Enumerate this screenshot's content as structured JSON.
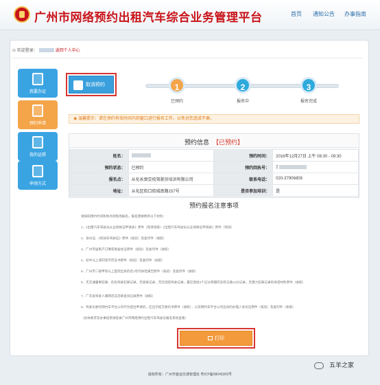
{
  "header": {
    "title": "广州市网络预约出租汽车综合业务管理平台",
    "nav": [
      "首页",
      "通知公告",
      "办事指南"
    ]
  },
  "breadcrumb": {
    "welcome": "欢迎登录：",
    "home": "返回个人中心"
  },
  "sidebar": {
    "items": [
      {
        "label": "我要办证",
        "active": false,
        "icon": "id-card-icon"
      },
      {
        "label": "预约申请",
        "active": true,
        "icon": "form-icon"
      },
      {
        "label": "我的证照",
        "active": false,
        "icon": "license-icon"
      },
      {
        "label": "申领方式",
        "active": false,
        "icon": "apply-icon"
      }
    ]
  },
  "cancel_button": {
    "label": "取消预约"
  },
  "progress": {
    "steps": [
      {
        "number": "1",
        "label": "已预约",
        "color": "#f4a54a"
      },
      {
        "number": "2",
        "label": "报名中",
        "color": "#2eaadc"
      },
      {
        "number": "3",
        "label": "报名完成",
        "color": "#2eaadc"
      }
    ]
  },
  "notice": {
    "text": "温馨提示：请在预约有效时间内到窗口进行报名工作，以免对您造成不便。"
  },
  "info": {
    "title": "预约信息",
    "status": "【已预约】",
    "rows": [
      [
        "姓名：",
        "",
        "预约时间：",
        "2016年12月27日 上午 08:30 - 09:30"
      ],
      [
        "预约状态：",
        "已预约",
        "预约回执号：",
        "2"
      ],
      [
        "报名点：",
        "从化长颈交校驾驶员培训有限公司",
        "联系电话：",
        "020-37906808"
      ],
      [
        "地址：",
        "从化区街口街城南路157号",
        "是否参加培训：",
        "是"
      ]
    ]
  },
  "registration": {
    "title": "预约报名注意事项",
    "lines": [
      "请按照预约时间和地点到现场报名，报名需要携带以下材料：",
      "1、《出租汽车驾驶员从业资格证申请表》原件（现场领取）《出租汽车驾驶员从业资格证申请表》原件（现场）",
      "2、身份证、《机动车驾驶证》原件（核验）及复印件（收取）",
      "3、广州市居民户口簿或者居住证原件（核验）及复印件（收取）",
      "4、初中以上或同等学历证书原件（核验）及复印件（收取）",
      "5、广州市二级甲等以上医院出具的近1年内体检报告原件（核验）及复印件（收取）",
      "6、无交通肇事犯罪、危险驾驶犯罪记录，无吸毒记录，无饮酒后驾驶记录，最近连续3个记分周期内没有记满12分记录，无暴力犯罪记录的承诺材料原件（收取）",
      "7、广东省驾驶人联网违法违章查询记录原件（收取）",
      "8、驾驶员委托网约车平台公司代为提出申请的，应出示提交委托书原件（收取），以及网约车平台公司出具的办理人身份证原件（核验）及复印件（收取）",
      "（具体要求及办事指南请登录广州市网络预约出租汽车驾驶员报名系统查看）"
    ]
  },
  "print_button": {
    "label": "打印"
  },
  "watermark": {
    "text": "五羊之家"
  },
  "footer": {
    "text": "版权所有：广州市客运交通管理处  粤ICP备08045309号"
  }
}
